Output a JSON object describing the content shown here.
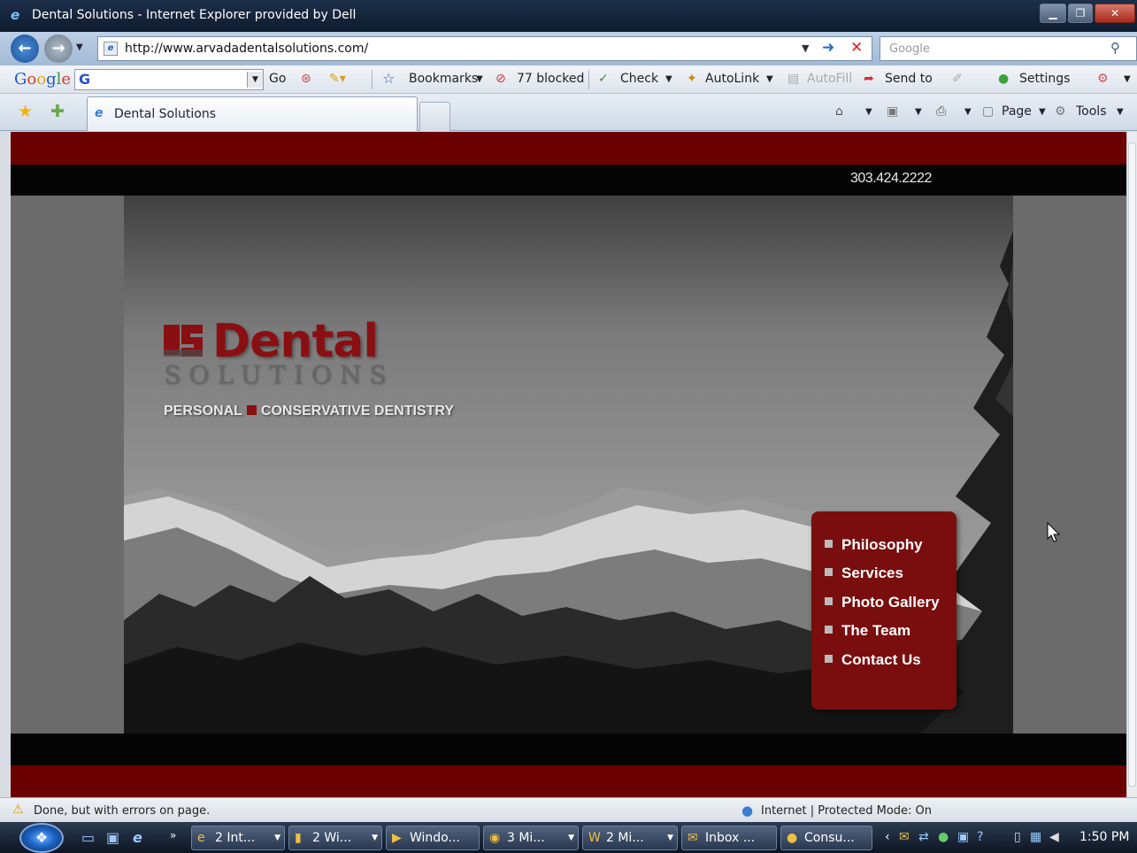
{
  "window": {
    "title": "Dental Solutions - Internet Explorer provided by Dell",
    "min_icon": "minimize-icon",
    "max_icon": "maximize-icon",
    "close_icon": "close-icon"
  },
  "address_bar": {
    "url": "http://www.arvadadentalsolutions.com/",
    "search_placeholder": "Google"
  },
  "google_toolbar": {
    "logo_letters": [
      "G",
      "o",
      "o",
      "g",
      "l",
      "e"
    ],
    "field_letter": "G",
    "go_label": "Go",
    "bookmarks_label": "Bookmarks",
    "blocked_label": "77 blocked",
    "check_label": "Check",
    "autolink_label": "AutoLink",
    "autofill_label": "AutoFill",
    "sendto_label": "Send to",
    "settings_label": "Settings"
  },
  "tabs": [
    {
      "label": "Dental Solutions"
    }
  ],
  "command_bar": {
    "page_label": "Page",
    "tools_label": "Tools"
  },
  "site": {
    "phone": "303.424.2222",
    "logo_word": "Dental",
    "logo_sub": "SOLUTIONS",
    "tagline_left": "PERSONAL",
    "tagline_right": "CONSERVATIVE DENTISTRY",
    "menu": [
      {
        "label": "Philosophy"
      },
      {
        "label": "Services"
      },
      {
        "label": "Photo Gallery"
      },
      {
        "label": "The Team"
      },
      {
        "label": "Contact Us"
      }
    ],
    "colors": {
      "brand_red": "#7a0d0e",
      "band_red": "#6b0000",
      "band_black": "#050505"
    }
  },
  "status_bar": {
    "status": "Done, but with errors on page.",
    "zone": "Internet | Protected Mode: On"
  },
  "taskbar": {
    "tasks": [
      {
        "label": "2 Int..."
      },
      {
        "label": "2 Wi..."
      },
      {
        "label": "Windo..."
      },
      {
        "label": "3 Mi..."
      },
      {
        "label": "2 Mi..."
      },
      {
        "label": "Inbox ..."
      },
      {
        "label": "Consu..."
      }
    ],
    "clock": "1:50 PM"
  }
}
